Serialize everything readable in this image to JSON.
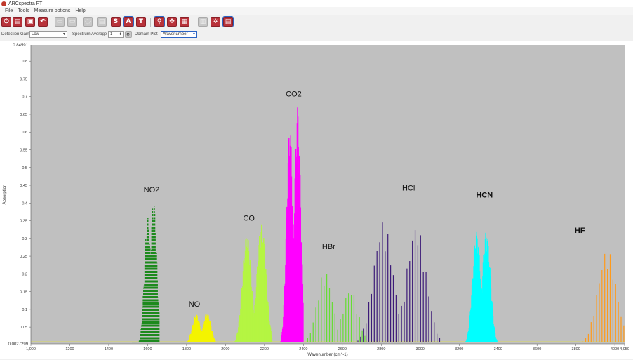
{
  "window": {
    "title": "ARCspectra FT"
  },
  "menu": [
    "File",
    "Tools",
    "Measure options",
    "Help"
  ],
  "toolbar": {
    "s_label": "S",
    "a_label": "A",
    "t_label": "T"
  },
  "options": {
    "detector_gain_label": "Detection Gain",
    "detector_gain_value": "Low",
    "spectrum_average_label": "Spectrum Average",
    "spectrum_average_value": "1",
    "domain_plot_label": "Domain Plot",
    "domain_plot_value": "Wavenumber"
  },
  "chart_data": {
    "type": "line",
    "title": "",
    "xlabel": "Wavenumber (cm^-1)",
    "ylabel": "Absorption",
    "xlim": [
      1000,
      4050
    ],
    "ylim": [
      0.0027299,
      0.84591
    ],
    "y_min_label": "0.0027299",
    "y_max_label": "0.84591",
    "x_tick_labels": [
      "1,000",
      "1200",
      "1400",
      "1600",
      "1800",
      "2000",
      "2200",
      "2400",
      "2600",
      "2800",
      "3000",
      "3200",
      "3400",
      "3600",
      "3800",
      "4000",
      "4,050"
    ],
    "y_tick_labels": [
      "0.05",
      "0.1",
      "0.15",
      "0.2",
      "0.25",
      "0.3",
      "0.35",
      "0.4",
      "0.45",
      "0.5",
      "0.55",
      "0.6",
      "0.65",
      "0.7",
      "0.75",
      "0.8"
    ],
    "grid": false,
    "background": "#c0c0c0",
    "series": [
      {
        "name": "NO2",
        "color": "#1e8a1e",
        "dashed": true,
        "bands": [
          {
            "center": 1600,
            "peak": 0.36
          },
          {
            "center": 1630,
            "peak": 0.41
          }
        ],
        "x_range": [
          1520,
          1660
        ]
      },
      {
        "name": "NO",
        "color": "#f4f400",
        "bands": [
          {
            "center": 1850,
            "peak": 0.085
          },
          {
            "center": 1905,
            "peak": 0.09
          }
        ],
        "x_range": [
          1780,
          1960
        ]
      },
      {
        "name": "CO",
        "color": "#b5f542",
        "bands": [
          {
            "center": 2110,
            "peak": 0.31
          },
          {
            "center": 2185,
            "peak": 0.34
          }
        ],
        "x_range": [
          2040,
          2240
        ]
      },
      {
        "name": "CO2",
        "color": "#ff00ff",
        "bands": [
          {
            "center": 2330,
            "peak": 0.62
          },
          {
            "center": 2370,
            "peak": 0.67
          }
        ],
        "x_range": [
          2260,
          2400
        ]
      },
      {
        "name": "HBr",
        "color": "#66dd33",
        "bands": [
          {
            "center": 2510,
            "peak": 0.21
          },
          {
            "center": 2640,
            "peak": 0.16
          }
        ],
        "x_range": [
          2380,
          2720
        ]
      },
      {
        "name": "HCl",
        "color": "#3c1a78",
        "bands": [
          {
            "center": 2810,
            "peak": 0.35
          },
          {
            "center": 2980,
            "peak": 0.34
          }
        ],
        "x_range": [
          2680,
          3110
        ]
      },
      {
        "name": "HCN",
        "color": "#00ffff",
        "bands": [
          {
            "center": 3290,
            "peak": 0.32
          },
          {
            "center": 3340,
            "peak": 0.32
          }
        ],
        "x_range": [
          3220,
          3400
        ]
      },
      {
        "name": "HF",
        "color": "#ff9a1a",
        "bands": [
          {
            "center": 3960,
            "peak": 0.27
          }
        ],
        "x_range": [
          3640,
          4050
        ]
      }
    ],
    "annotations": [
      {
        "text": "NO2",
        "x": 1620,
        "y": 0.43
      },
      {
        "text": "NO",
        "x": 1840,
        "y": 0.108
      },
      {
        "text": "CO",
        "x": 2120,
        "y": 0.35
      },
      {
        "text": "CO2",
        "x": 2350,
        "y": 0.7
      },
      {
        "text": "HBr",
        "x": 2530,
        "y": 0.27
      },
      {
        "text": "HCl",
        "x": 2940,
        "y": 0.435
      },
      {
        "text": "HCN",
        "x": 3330,
        "y": 0.415
      },
      {
        "text": "HF",
        "x": 3820,
        "y": 0.315
      }
    ]
  }
}
